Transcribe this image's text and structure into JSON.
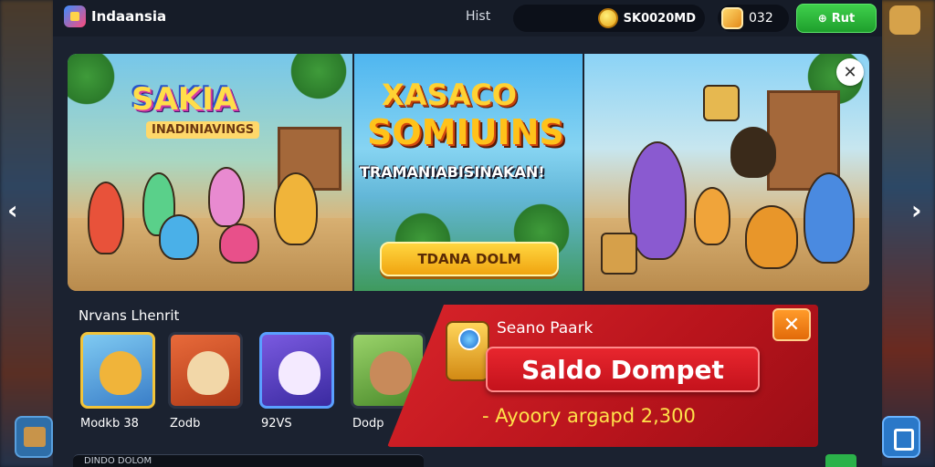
{
  "header": {
    "brand_title": "Indaansia",
    "history_label": "Hist",
    "coin_value": "SK0020MD",
    "gem_value": "032",
    "topup_label": "Rut"
  },
  "banner": {
    "panel1_title": "SAKIA",
    "panel1_subtitle": "INADINIAVINGS",
    "panel2_title_top": "XASACO",
    "panel2_title_main": "SOMIUINS",
    "panel2_tagline": "TRAMANIABISINAKAN!",
    "panel2_button": "TDANA DOLM"
  },
  "games_section": {
    "title": "Nrvans Lhenrit",
    "games": [
      {
        "label": "Modkb 38"
      },
      {
        "label": "Zodb"
      },
      {
        "label": "92VS"
      },
      {
        "label": "Dodp"
      }
    ]
  },
  "popup": {
    "heading": "Seano Paark",
    "title": "Saldo Dompet",
    "subtitle": "- Ayoory argapd 2,300"
  },
  "bottom_bar": {
    "text": "DINDO DOLOM"
  },
  "colors": {
    "accent_green": "#2bb24a",
    "popup_red": "#d9242a",
    "coin_gold": "#ffd34a"
  },
  "icons": {
    "brand": "brand-logo-icon",
    "coin": "coin-icon",
    "gem": "gem-icon",
    "close": "close-icon",
    "chevron_left": "chevron-left-icon",
    "chevron_right": "chevron-right-icon"
  }
}
